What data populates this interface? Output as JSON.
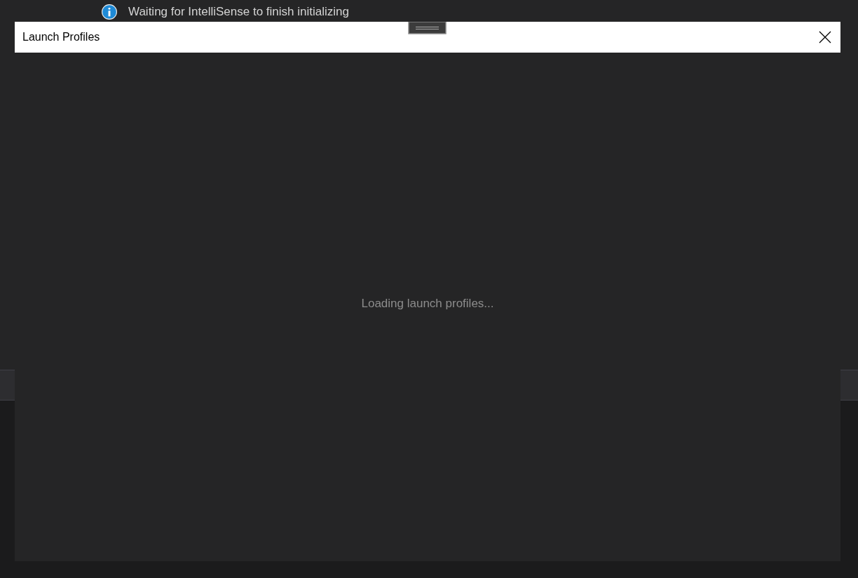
{
  "background": {
    "notification": {
      "text": "Waiting for IntelliSense to finish initializing"
    }
  },
  "dialog": {
    "title": "Launch Profiles",
    "status_text": "Loading launch profiles..."
  }
}
